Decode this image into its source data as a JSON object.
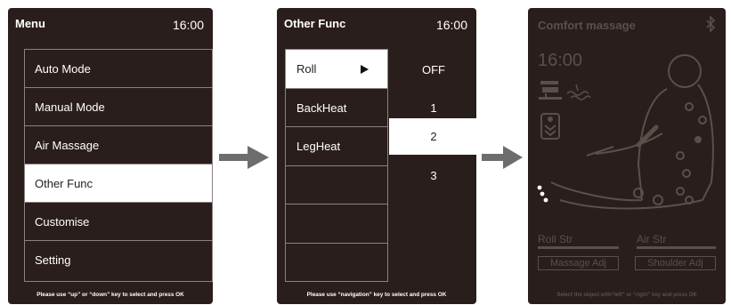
{
  "screen1": {
    "title": "Menu",
    "clock": "16:00",
    "items": [
      {
        "label": "Auto Mode"
      },
      {
        "label": "Manual Mode"
      },
      {
        "label": "Air Massage"
      },
      {
        "label": "Other Func"
      },
      {
        "label": "Customise"
      },
      {
        "label": "Setting"
      }
    ],
    "selected_index": 3,
    "hint": "Please use “up” or “down” key to select and press OK"
  },
  "screen2": {
    "title": "Other Func",
    "clock": "16:00",
    "functions": [
      {
        "label": "Roll"
      },
      {
        "label": "BackHeat"
      },
      {
        "label": "LegHeat"
      },
      {
        "label": ""
      },
      {
        "label": ""
      },
      {
        "label": ""
      }
    ],
    "selected_function": "Roll",
    "options": [
      "OFF",
      "1",
      "2",
      "3"
    ],
    "selected_option": "2",
    "hint": "Please use “navigation” key to select and press OK"
  },
  "screen3": {
    "title": "Comfort massage",
    "clock": "16:00",
    "bluetooth_icon": "bluetooth-icon",
    "roll_label": "Roll Str",
    "air_label": "Air Str",
    "massage_adj_label": "Massage Adj",
    "shoulder_adj_label": "Shoulder Adj",
    "hint": "Select the object with“left” or “right” key and press OK"
  },
  "colors": {
    "screen_bg": "#2a1e1c",
    "dim": "#5b4f4c",
    "selection": "#ffffff",
    "arrow": "#6d6d6d"
  }
}
